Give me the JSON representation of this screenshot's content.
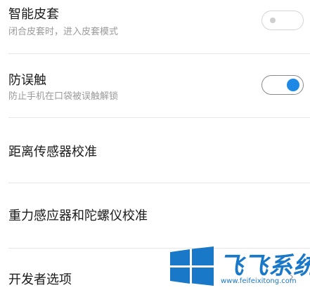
{
  "settings": {
    "smart_cover": {
      "title": "智能皮套",
      "subtitle": "闭合皮套时，进入皮套模式",
      "enabled": false
    },
    "anti_mistouch": {
      "title": "防误触",
      "subtitle": "防止手机在口袋被误触解锁",
      "enabled": true
    },
    "proximity_calibration": {
      "title": "距离传感器校准"
    },
    "gravity_calibration": {
      "title": "重力感应器和陀螺仪校准"
    },
    "developer_options": {
      "title": "开发者选项"
    }
  },
  "watermark": {
    "brand": "飞飞系统",
    "url": "www.feifeixitong.com"
  },
  "colors": {
    "accent": "#1e88e5",
    "watermark": "#1a78c9"
  }
}
